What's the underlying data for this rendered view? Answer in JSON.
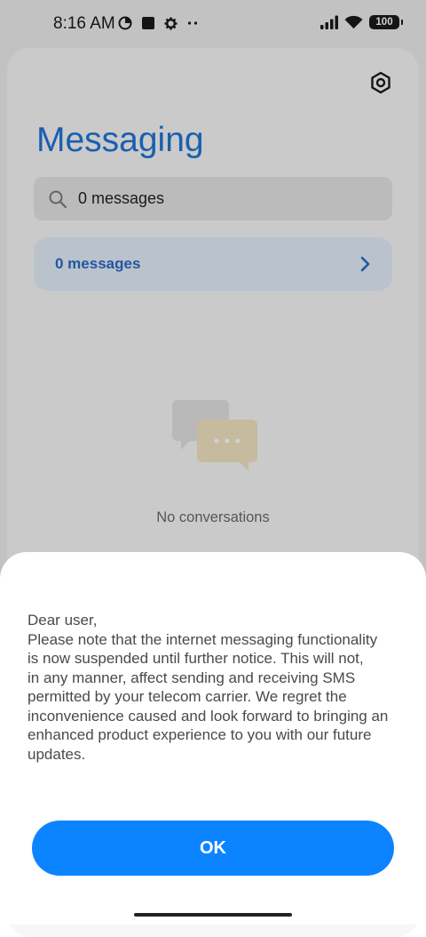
{
  "status_bar": {
    "time": "8:16 AM",
    "battery": "100",
    "left_icons": [
      "data-saver-icon",
      "square-notification-icon",
      "gear-notification-icon",
      "more-dots-icon"
    ],
    "right_icons": [
      "signal-icon",
      "wifi-icon",
      "battery-icon"
    ]
  },
  "app": {
    "title": "Messaging",
    "search": {
      "value": "0 messages",
      "icon": "search-icon"
    },
    "messages_row": {
      "label": "0 messages",
      "icon": "chevron-right-icon"
    },
    "empty_state": {
      "text": "No conversations",
      "icon": "chat-bubbles-icon"
    },
    "settings_icon": "settings-icon"
  },
  "dialog": {
    "message": "Dear user,\nPlease note that the internet messaging functionality\nis now suspended until further notice. This will not,\nin any manner, affect sending and receiving SMS\npermitted by your telecom carrier. We regret the\ninconvenience caused and look forward to bringing an\nenhanced product experience to you with our future\nupdates.",
    "ok_label": "OK"
  },
  "colors": {
    "accent": "#0d84ff",
    "title": "#1f74d6",
    "link": "#2a6bc4",
    "chip_background": "#e3edf8"
  }
}
